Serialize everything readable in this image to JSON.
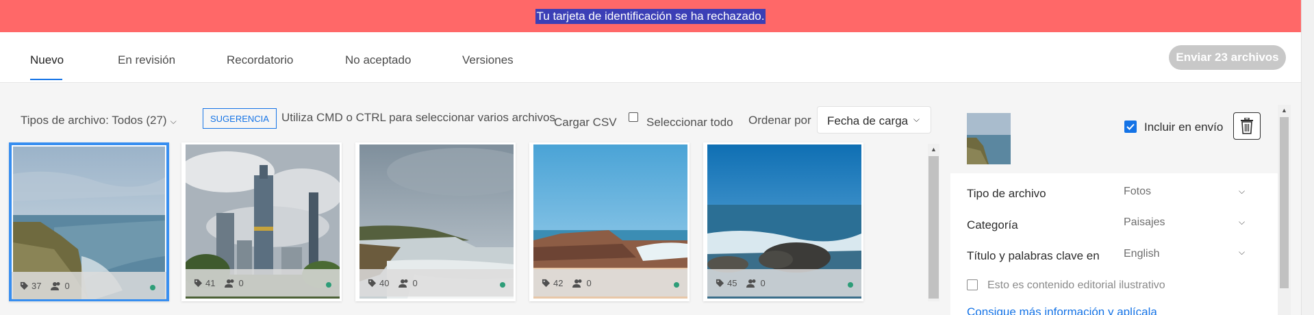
{
  "banner": {
    "message": "Tu tarjeta de identificación se ha rechazado."
  },
  "tabs": [
    {
      "label": "Nuevo",
      "active": true
    },
    {
      "label": "En revisión"
    },
    {
      "label": "Recordatorio"
    },
    {
      "label": "No aceptado"
    },
    {
      "label": "Versiones"
    }
  ],
  "send_button": "Enviar 23 archivos",
  "toolbar": {
    "file_types": "Tipos de archivo: Todos (27)",
    "hint_badge": "SUGERENCIA",
    "hint_text": "Utiliza CMD o CTRL para seleccionar varios archivos",
    "csv": "Cargar CSV",
    "select_all": "Seleccionar todo",
    "sort_label": "Ordenar por",
    "sort_value": "Fecha de carga"
  },
  "cards": [
    {
      "keywords": "37",
      "people": "0",
      "selected": true
    },
    {
      "keywords": "41",
      "people": "0"
    },
    {
      "keywords": "40",
      "people": "0"
    },
    {
      "keywords": "42",
      "people": "0"
    },
    {
      "keywords": "45",
      "people": "0"
    }
  ],
  "panel": {
    "include_label": "Incluir en envío",
    "rows": [
      {
        "label": "Tipo de archivo",
        "value": "Fotos"
      },
      {
        "label": "Categoría",
        "value": "Paisajes"
      },
      {
        "label": "Título y palabras clave en",
        "value": "English"
      }
    ],
    "editorial": "Esto es contenido editorial ilustrativo",
    "more_link": "Consigue más información y aplícala"
  },
  "colors": {
    "banner": "#ff6868",
    "accent": "#1473e6",
    "status_ok": "#2d9d78"
  }
}
